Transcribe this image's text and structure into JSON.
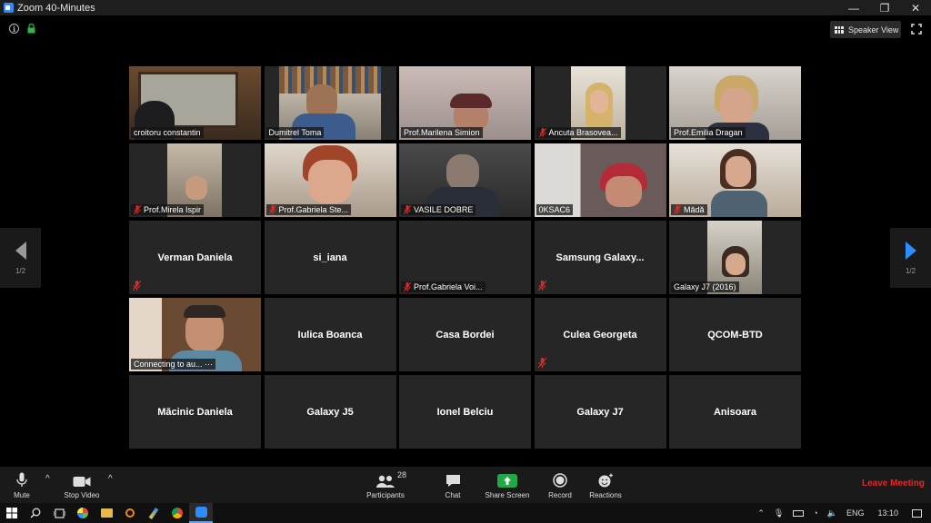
{
  "window": {
    "title": "Zoom 40-Minutes",
    "minimize": "—",
    "restore": "❐",
    "close": "✕"
  },
  "topbar": {
    "info_icon": "info-icon",
    "lock_icon": "lock-icon",
    "speaker_view_label": "Speaker View",
    "fullscreen_icon": "fullscreen-icon"
  },
  "nav": {
    "left_page": "1/2",
    "right_page": "1/2"
  },
  "participants": [
    {
      "name": "croitoru constantin",
      "video": true,
      "muted": false,
      "active": true
    },
    {
      "name": "Dumitrel Toma",
      "video": true,
      "muted": false
    },
    {
      "name": "Prof.Marilena Simion",
      "video": true,
      "muted": false
    },
    {
      "name": "Ancuta Brasovea...",
      "video": true,
      "muted": true
    },
    {
      "name": "Prof.Emilia Dragan",
      "video": true,
      "muted": false
    },
    {
      "name": "Prof.Mirela Ispir",
      "video": true,
      "muted": true
    },
    {
      "name": "Prof.Gabriela Ste...",
      "video": true,
      "muted": true
    },
    {
      "name": "VASILE DOBRE",
      "video": true,
      "muted": true
    },
    {
      "name": "0KSAC6",
      "video": true,
      "muted": false
    },
    {
      "name": "Mădă",
      "video": true,
      "muted": true
    },
    {
      "name": "Verman Daniela",
      "video": false,
      "muted": true
    },
    {
      "name": "si_iana",
      "video": false,
      "muted": false
    },
    {
      "name": "Prof.Gabriela Voi...",
      "video": false,
      "muted": true,
      "label_only": true
    },
    {
      "name": "Samsung  Galaxy...",
      "video": false,
      "muted": true
    },
    {
      "name": "Galaxy J7 (2016)",
      "video": true,
      "muted": false
    },
    {
      "name": "Connecting to au... ···",
      "video": true,
      "muted": false
    },
    {
      "name": "Iulica Boanca",
      "video": false,
      "muted": false
    },
    {
      "name": "Casa Bordei",
      "video": false,
      "muted": false
    },
    {
      "name": "Culea Georgeta",
      "video": false,
      "muted": true
    },
    {
      "name": "QCOM-BTD",
      "video": false,
      "muted": false
    },
    {
      "name": "Măcinic Daniela",
      "video": false,
      "muted": false
    },
    {
      "name": "Galaxy J5",
      "video": false,
      "muted": false
    },
    {
      "name": "Ionel Belciu",
      "video": false,
      "muted": false
    },
    {
      "name": "Galaxy J7",
      "video": false,
      "muted": false
    },
    {
      "name": "Anisoara",
      "video": false,
      "muted": false
    }
  ],
  "toolbar": {
    "mute_label": "Mute",
    "stop_video_label": "Stop Video",
    "participants_label": "Participants",
    "participants_count": "28",
    "chat_label": "Chat",
    "share_screen_label": "Share Screen",
    "record_label": "Record",
    "reactions_label": "Reactions",
    "leave_label": "Leave Meeting",
    "caret": "^"
  },
  "taskbar": {
    "language": "ENG",
    "time": "13:10"
  },
  "colors": {
    "accent": "#2d8cff",
    "active_border": "#d8e04a",
    "leave": "#e02828",
    "share_green": "#23a849",
    "mute_red": "#e02828"
  }
}
